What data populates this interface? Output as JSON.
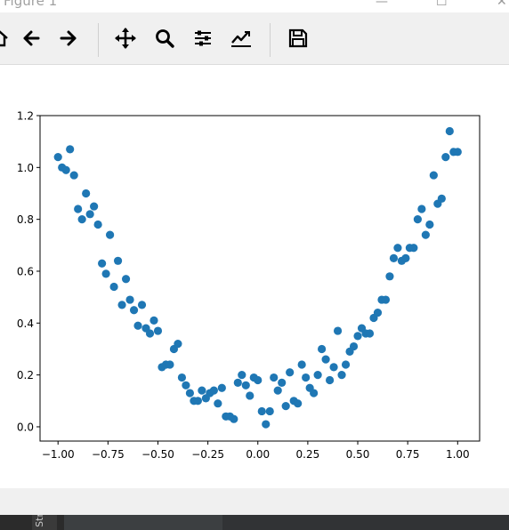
{
  "window": {
    "title": "Figure 1"
  },
  "window_controls": {
    "minimize": "—",
    "maximize": "☐",
    "close": "✕"
  },
  "toolbar": {
    "buttons": [
      {
        "name": "home-button",
        "icon": "home-icon"
      },
      {
        "name": "back-button",
        "icon": "arrow-left-icon"
      },
      {
        "name": "forward-button",
        "icon": "arrow-right-icon"
      },
      {
        "name": "pan-button",
        "icon": "move-icon"
      },
      {
        "name": "zoom-button",
        "icon": "magnifier-icon"
      },
      {
        "name": "subplots-button",
        "icon": "sliders-icon"
      },
      {
        "name": "edit-axes-button",
        "icon": "line-chart-icon"
      },
      {
        "name": "save-button",
        "icon": "floppy-disk-icon"
      }
    ]
  },
  "taskbar": {
    "label": "Str"
  },
  "chart_data": {
    "type": "scatter",
    "title": "",
    "xlabel": "",
    "ylabel": "",
    "xlim": [
      -1.09,
      1.11
    ],
    "ylim": [
      -0.055,
      1.2
    ],
    "xticks": [
      -1.0,
      -0.75,
      -0.5,
      -0.25,
      0.0,
      0.25,
      0.5,
      0.75,
      1.0
    ],
    "xtick_labels": [
      "−1.00",
      "−0.75",
      "−0.50",
      "−0.25",
      "0.00",
      "0.25",
      "0.50",
      "0.75",
      "1.00"
    ],
    "yticks": [
      0.0,
      0.2,
      0.4,
      0.6,
      0.8,
      1.0,
      1.2
    ],
    "ytick_labels": [
      "0.0",
      "0.2",
      "0.4",
      "0.6",
      "0.8",
      "1.0",
      "1.2"
    ],
    "grid": false,
    "marker_color": "#1f77b4",
    "series": [
      {
        "x": [
          -1.0,
          -0.98,
          -0.96,
          -0.94,
          -0.92,
          -0.9,
          -0.88,
          -0.86,
          -0.84,
          -0.82,
          -0.8,
          -0.78,
          -0.76,
          -0.74,
          -0.72,
          -0.7,
          -0.68,
          -0.66,
          -0.64,
          -0.62,
          -0.6,
          -0.58,
          -0.56,
          -0.54,
          -0.52,
          -0.5,
          -0.48,
          -0.46,
          -0.44,
          -0.42,
          -0.4,
          -0.38,
          -0.36,
          -0.34,
          -0.32,
          -0.3,
          -0.28,
          -0.26,
          -0.24,
          -0.22,
          -0.2,
          -0.18,
          -0.16,
          -0.14,
          -0.12,
          -0.1,
          -0.08,
          -0.06,
          -0.04,
          -0.02,
          0.0,
          0.02,
          0.04,
          0.06,
          0.08,
          0.1,
          0.12,
          0.14,
          0.16,
          0.18,
          0.2,
          0.22,
          0.24,
          0.26,
          0.28,
          0.3,
          0.32,
          0.34,
          0.36,
          0.38,
          0.4,
          0.42,
          0.44,
          0.46,
          0.48,
          0.5,
          0.52,
          0.54,
          0.56,
          0.58,
          0.6,
          0.62,
          0.64,
          0.66,
          0.68,
          0.7,
          0.72,
          0.74,
          0.76,
          0.78,
          0.8,
          0.82,
          0.84,
          0.86,
          0.88,
          0.9,
          0.92,
          0.94,
          0.96,
          0.98,
          1.0
        ],
        "y": [
          1.04,
          1.0,
          0.99,
          1.07,
          0.97,
          0.84,
          0.8,
          0.9,
          0.82,
          0.85,
          0.78,
          0.63,
          0.59,
          0.74,
          0.54,
          0.64,
          0.47,
          0.57,
          0.49,
          0.45,
          0.39,
          0.47,
          0.38,
          0.36,
          0.41,
          0.37,
          0.23,
          0.24,
          0.24,
          0.3,
          0.32,
          0.19,
          0.16,
          0.13,
          0.1,
          0.1,
          0.14,
          0.11,
          0.13,
          0.14,
          0.09,
          0.15,
          0.04,
          0.04,
          0.03,
          0.17,
          0.2,
          0.16,
          0.12,
          0.19,
          0.18,
          0.06,
          0.01,
          0.06,
          0.19,
          0.14,
          0.17,
          0.08,
          0.21,
          0.1,
          0.09,
          0.24,
          0.19,
          0.15,
          0.13,
          0.2,
          0.3,
          0.26,
          0.18,
          0.23,
          0.37,
          0.2,
          0.24,
          0.29,
          0.31,
          0.35,
          0.38,
          0.36,
          0.36,
          0.42,
          0.44,
          0.49,
          0.49,
          0.58,
          0.65,
          0.69,
          0.64,
          0.65,
          0.69,
          0.69,
          0.8,
          0.84,
          0.74,
          0.78,
          0.97,
          0.86,
          0.88,
          1.04,
          1.14,
          1.06,
          1.06
        ]
      }
    ]
  }
}
